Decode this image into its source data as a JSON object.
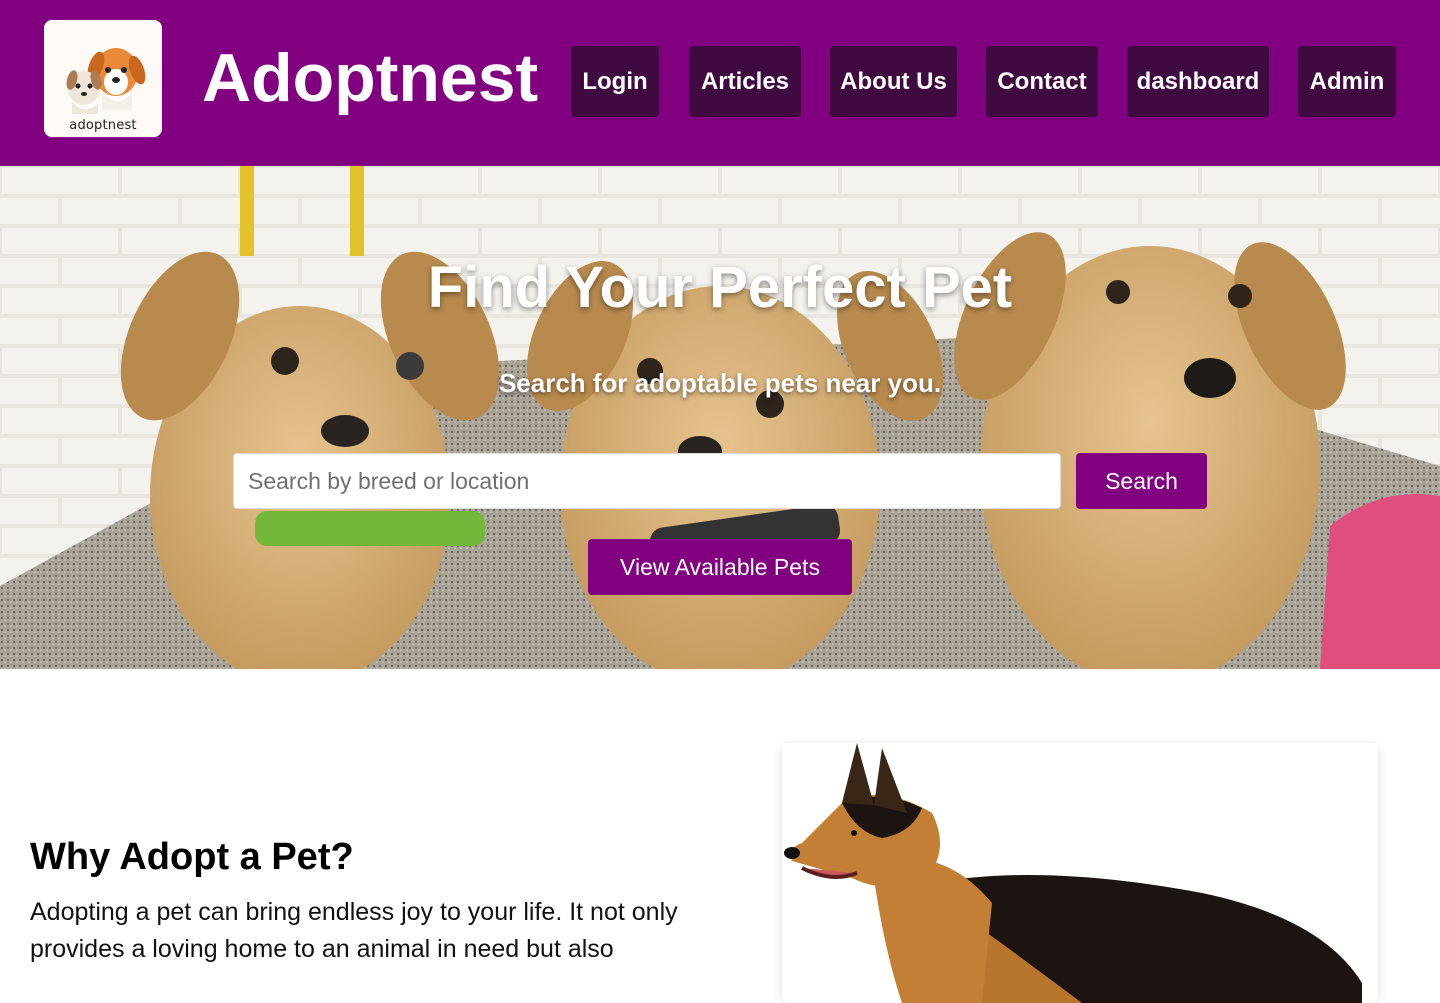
{
  "header": {
    "logo_text": "adoptnest",
    "brand": "Adoptnest",
    "nav": [
      {
        "label": "Login"
      },
      {
        "label": "Articles"
      },
      {
        "label": "About Us"
      },
      {
        "label": "Contact"
      },
      {
        "label": "dashboard"
      },
      {
        "label": "Admin"
      }
    ]
  },
  "hero": {
    "title": "Find Your Perfect Pet",
    "subtitle": "Search for adoptable pets near you.",
    "search_placeholder": "Search by breed or location",
    "search_button": "Search",
    "view_button": "View Available Pets",
    "image": "three-puppies-photo"
  },
  "why": {
    "title": "Why Adopt a Pet?",
    "text": "Adopting a pet can bring endless joy to your life. It not only provides a loving home to an animal in need but also",
    "image": "german-shepherd-photo"
  },
  "colors": {
    "brand_purple": "#800080",
    "nav_button": "#3f0a3f"
  }
}
